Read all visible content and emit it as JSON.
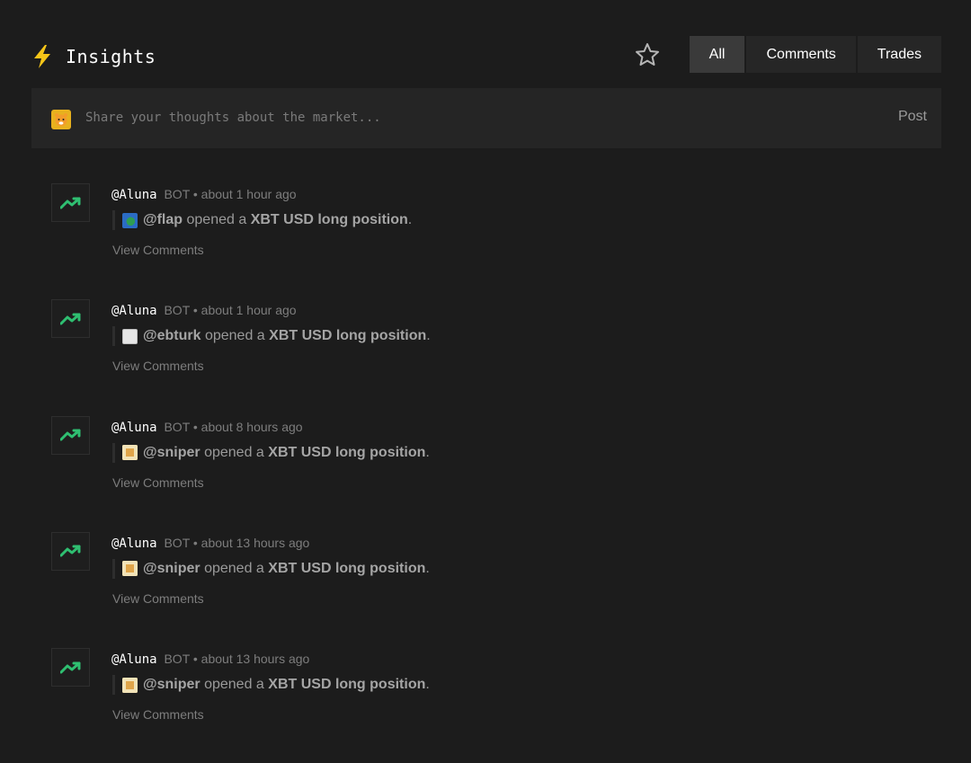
{
  "header": {
    "title": "Insights",
    "bolt_icon": "lightning-bolt-icon",
    "star_icon": "star-outline-icon",
    "tabs": [
      {
        "label": "All",
        "active": true
      },
      {
        "label": "Comments",
        "active": false
      },
      {
        "label": "Trades",
        "active": false
      }
    ]
  },
  "composer": {
    "avatar_icon": "tiger-avatar-icon",
    "placeholder": "Share your thoughts about the market...",
    "post_label": "Post"
  },
  "feed": [
    {
      "author": "@Aluna",
      "tag": "BOT",
      "time": "• about 1 hour ago",
      "user": "@flap",
      "verb": "opened a",
      "position": "XBT USD long position",
      "end": ".",
      "view": "View Comments"
    },
    {
      "author": "@Aluna",
      "tag": "BOT",
      "time": "• about 1 hour ago",
      "user": "@ebturk",
      "verb": "opened a",
      "position": "XBT USD long position",
      "end": ".",
      "view": "View Comments"
    },
    {
      "author": "@Aluna",
      "tag": "BOT",
      "time": "• about 8 hours ago",
      "user": "@sniper",
      "verb": "opened a",
      "position": "XBT USD long position",
      "end": ".",
      "view": "View Comments"
    },
    {
      "author": "@Aluna",
      "tag": "BOT",
      "time": "• about 13 hours ago",
      "user": "@sniper",
      "verb": "opened a",
      "position": "XBT USD long position",
      "end": ".",
      "view": "View Comments"
    },
    {
      "author": "@Aluna",
      "tag": "BOT",
      "time": "• about 13 hours ago",
      "user": "@sniper",
      "verb": "opened a",
      "position": "XBT USD long position",
      "end": ".",
      "view": "View Comments"
    }
  ],
  "colors": {
    "background": "#1c1c1c",
    "trend_green": "#2fbf71",
    "bolt_yellow": "#f5c518"
  }
}
